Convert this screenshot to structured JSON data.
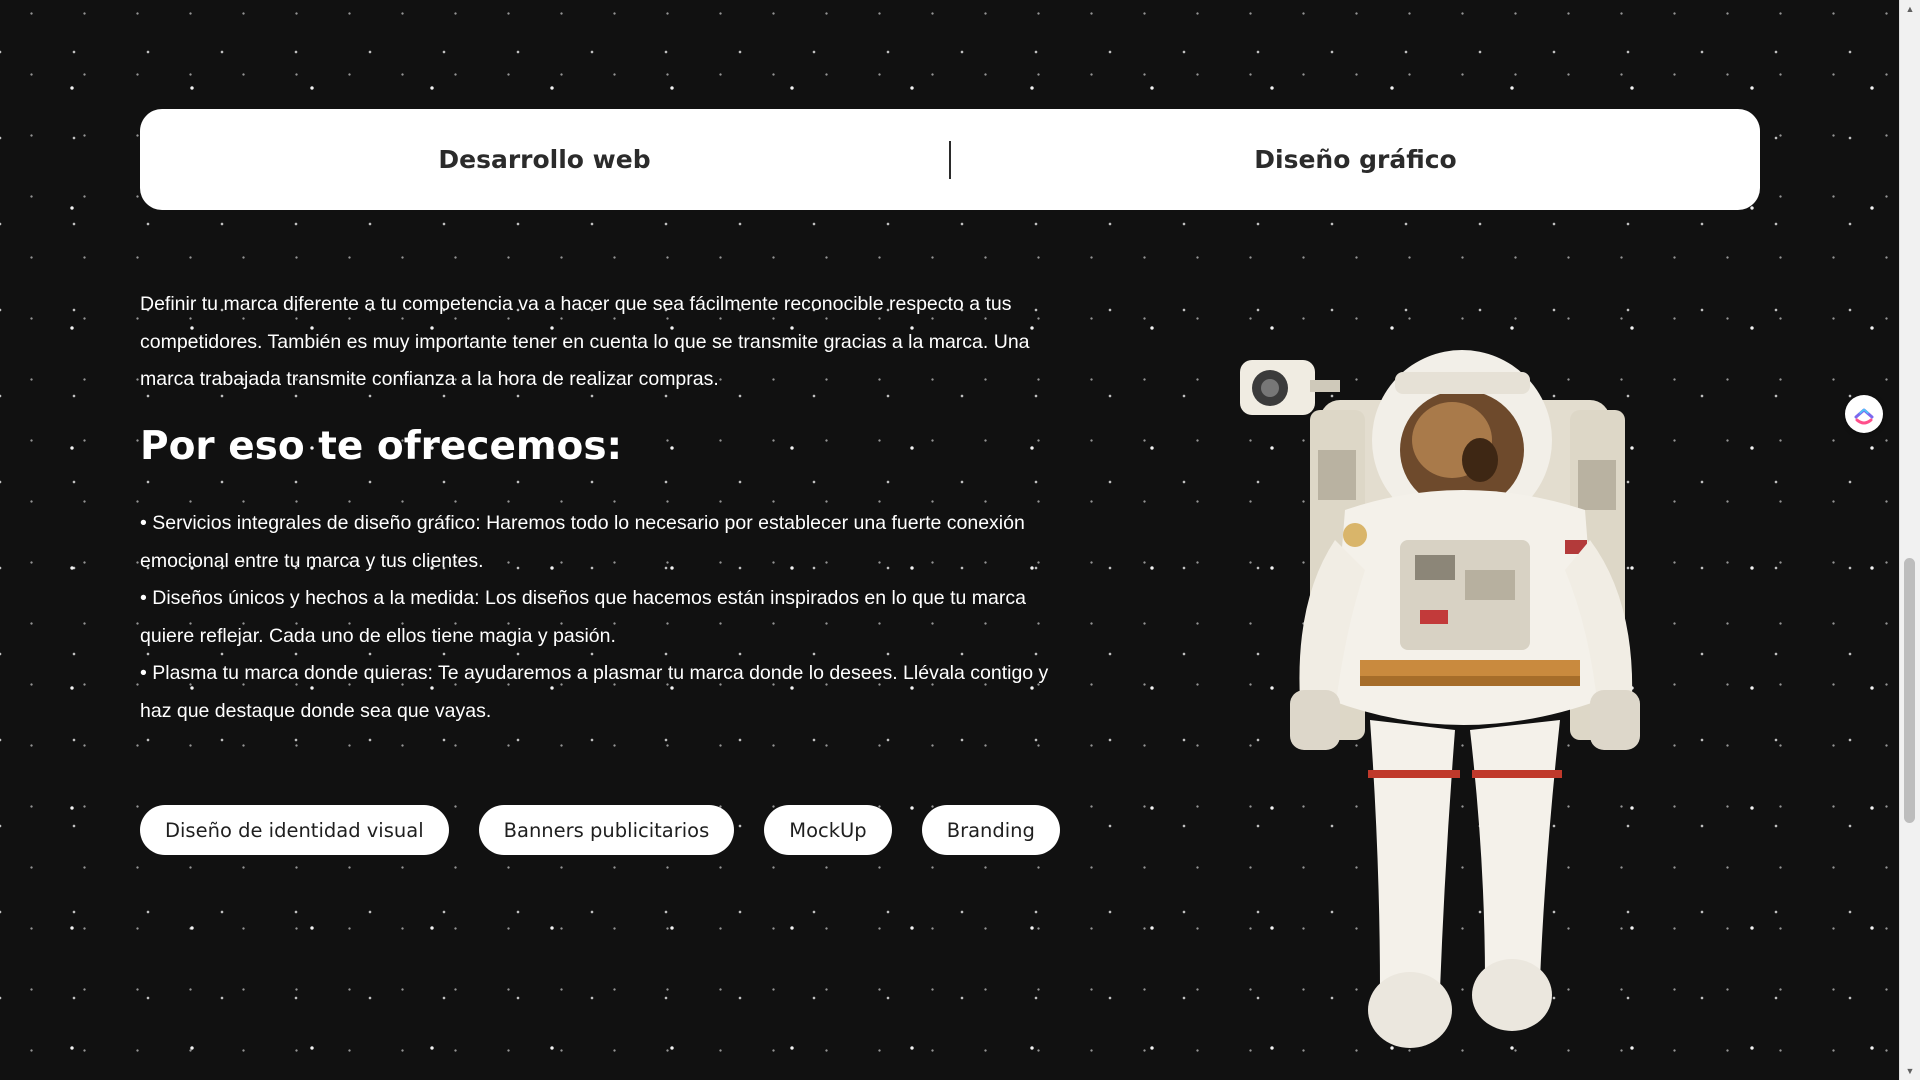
{
  "tabs": [
    {
      "label": "Desarrollo web"
    },
    {
      "label": "Diseño gráfico"
    }
  ],
  "intro": "Definir tu marca diferente a tu competencia va a hacer que sea fácilmente reconocible respecto a tus competidores. También es muy importante tener en cuenta lo que se transmite gracias a la marca. Una marca trabajada transmite confianza a la hora de realizar compras.",
  "heading": "Por eso te ofrecemos:",
  "services": [
    "• Servicios integrales de diseño gráfico: Haremos todo lo necesario por establecer una fuerte conexión emocional entre tu marca y tus clientes.",
    "• Diseños únicos y hechos a la medida: Los diseños que hacemos están inspirados en lo que tu marca quiere reflejar. Cada uno de ellos tiene magia y pasión.",
    "• Plasma tu marca donde quieras: Te ayudaremos a plasmar tu marca donde lo desees. Llévala contigo y haz que destaque donde sea que vayas."
  ],
  "pills": [
    "Diseño de identidad visual",
    "Banners publicitarios",
    "MockUp",
    "Branding"
  ],
  "icons": {
    "widget": "clickup-icon",
    "scroll_up": "scroll-up-arrow-icon",
    "scroll_down": "scroll-down-arrow-icon"
  },
  "colors": {
    "background": "#111111",
    "card": "#ffffff",
    "text_dark": "#2b2b2b"
  }
}
